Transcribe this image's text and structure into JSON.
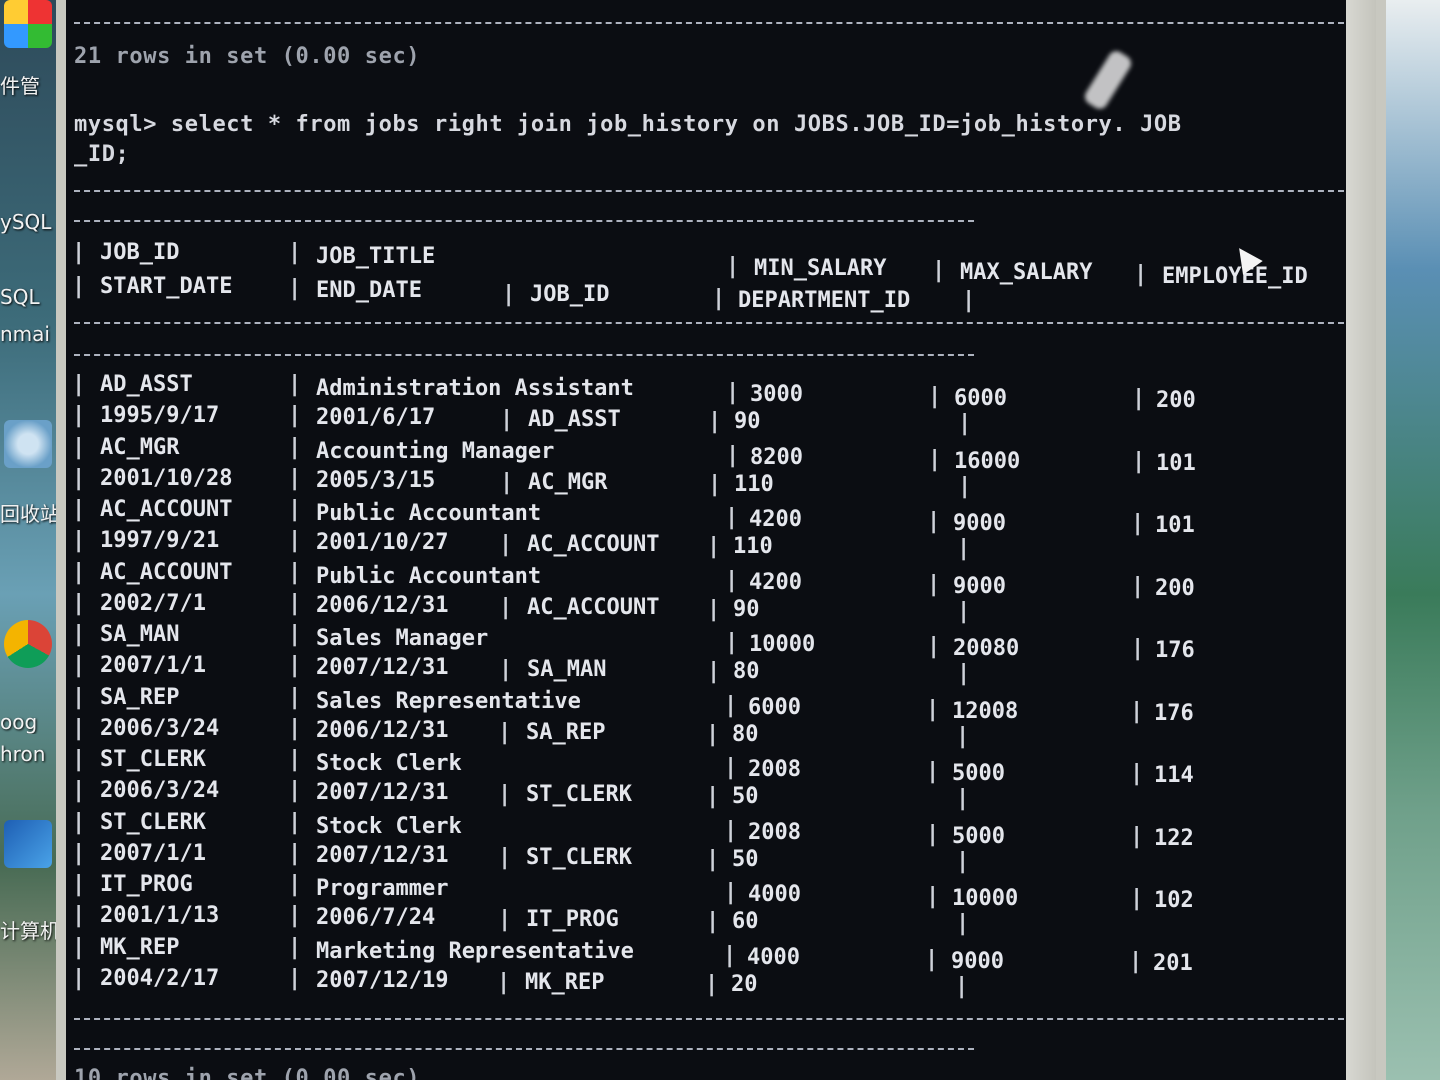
{
  "desktop": {
    "labels": [
      "件管",
      "ySQL",
      "SQL",
      "nmai",
      "回收站",
      "oog",
      "hron",
      "计算机"
    ],
    "icons": [
      "recycle-bin-icon",
      "chrome-icon",
      "computer-icon"
    ]
  },
  "console": {
    "prev_result": "21 rows in set (0.00 sec)",
    "query_line1": "mysql> select * from jobs right join job_history on JOBS.JOB_ID=job_history. JOB",
    "query_line2": "_ID;",
    "footer": "10 rows in set (0.00 sec)",
    "header": {
      "row1": [
        "JOB_ID",
        "JOB_TITLE",
        "MIN_SALARY",
        "MAX_SALARY",
        "EMPLOYEE_ID"
      ],
      "row2": [
        "START_DATE",
        "END_DATE",
        "JOB_ID",
        "DEPARTMENT_ID"
      ]
    },
    "rows": [
      {
        "job_id": "AD_ASST",
        "job_title": "Administration Assistant",
        "min_salary": "3000",
        "max_salary": "6000",
        "employee_id": "200",
        "start_date": "1995/9/17",
        "end_date": "2001/6/17",
        "job_id2": "AD_ASST",
        "department_id": "90"
      },
      {
        "job_id": "AC_MGR",
        "job_title": "Accounting Manager",
        "min_salary": "8200",
        "max_salary": "16000",
        "employee_id": "101",
        "start_date": "2001/10/28",
        "end_date": "2005/3/15",
        "job_id2": "AC_MGR",
        "department_id": "110"
      },
      {
        "job_id": "AC_ACCOUNT",
        "job_title": "Public Accountant",
        "min_salary": "4200",
        "max_salary": "9000",
        "employee_id": "101",
        "start_date": "1997/9/21",
        "end_date": "2001/10/27",
        "job_id2": "AC_ACCOUNT",
        "department_id": "110"
      },
      {
        "job_id": "AC_ACCOUNT",
        "job_title": "Public Accountant",
        "min_salary": "4200",
        "max_salary": "9000",
        "employee_id": "200",
        "start_date": "2002/7/1",
        "end_date": "2006/12/31",
        "job_id2": "AC_ACCOUNT",
        "department_id": "90"
      },
      {
        "job_id": "SA_MAN",
        "job_title": "Sales Manager",
        "min_salary": "10000",
        "max_salary": "20080",
        "employee_id": "176",
        "start_date": "2007/1/1",
        "end_date": "2007/12/31",
        "job_id2": "SA_MAN",
        "department_id": "80"
      },
      {
        "job_id": "SA_REP",
        "job_title": "Sales Representative",
        "min_salary": "6000",
        "max_salary": "12008",
        "employee_id": "176",
        "start_date": "2006/3/24",
        "end_date": "2006/12/31",
        "job_id2": "SA_REP",
        "department_id": "80"
      },
      {
        "job_id": "ST_CLERK",
        "job_title": "Stock Clerk",
        "min_salary": "2008",
        "max_salary": "5000",
        "employee_id": "114",
        "start_date": "2006/3/24",
        "end_date": "2007/12/31",
        "job_id2": "ST_CLERK",
        "department_id": "50"
      },
      {
        "job_id": "ST_CLERK",
        "job_title": "Stock Clerk",
        "min_salary": "2008",
        "max_salary": "5000",
        "employee_id": "122",
        "start_date": "2007/1/1",
        "end_date": "2007/12/31",
        "job_id2": "ST_CLERK",
        "department_id": "50"
      },
      {
        "job_id": "IT_PROG",
        "job_title": "Programmer",
        "min_salary": "4000",
        "max_salary": "10000",
        "employee_id": "102",
        "start_date": "2001/1/13",
        "end_date": "2006/7/24",
        "job_id2": "IT_PROG",
        "department_id": "60"
      },
      {
        "job_id": "MK_REP",
        "job_title": "Marketing Representative",
        "min_salary": "4000",
        "max_salary": "9000",
        "employee_id": "201",
        "start_date": "2004/2/17",
        "end_date": "2007/12/19",
        "job_id2": "MK_REP",
        "department_id": "20"
      }
    ]
  }
}
